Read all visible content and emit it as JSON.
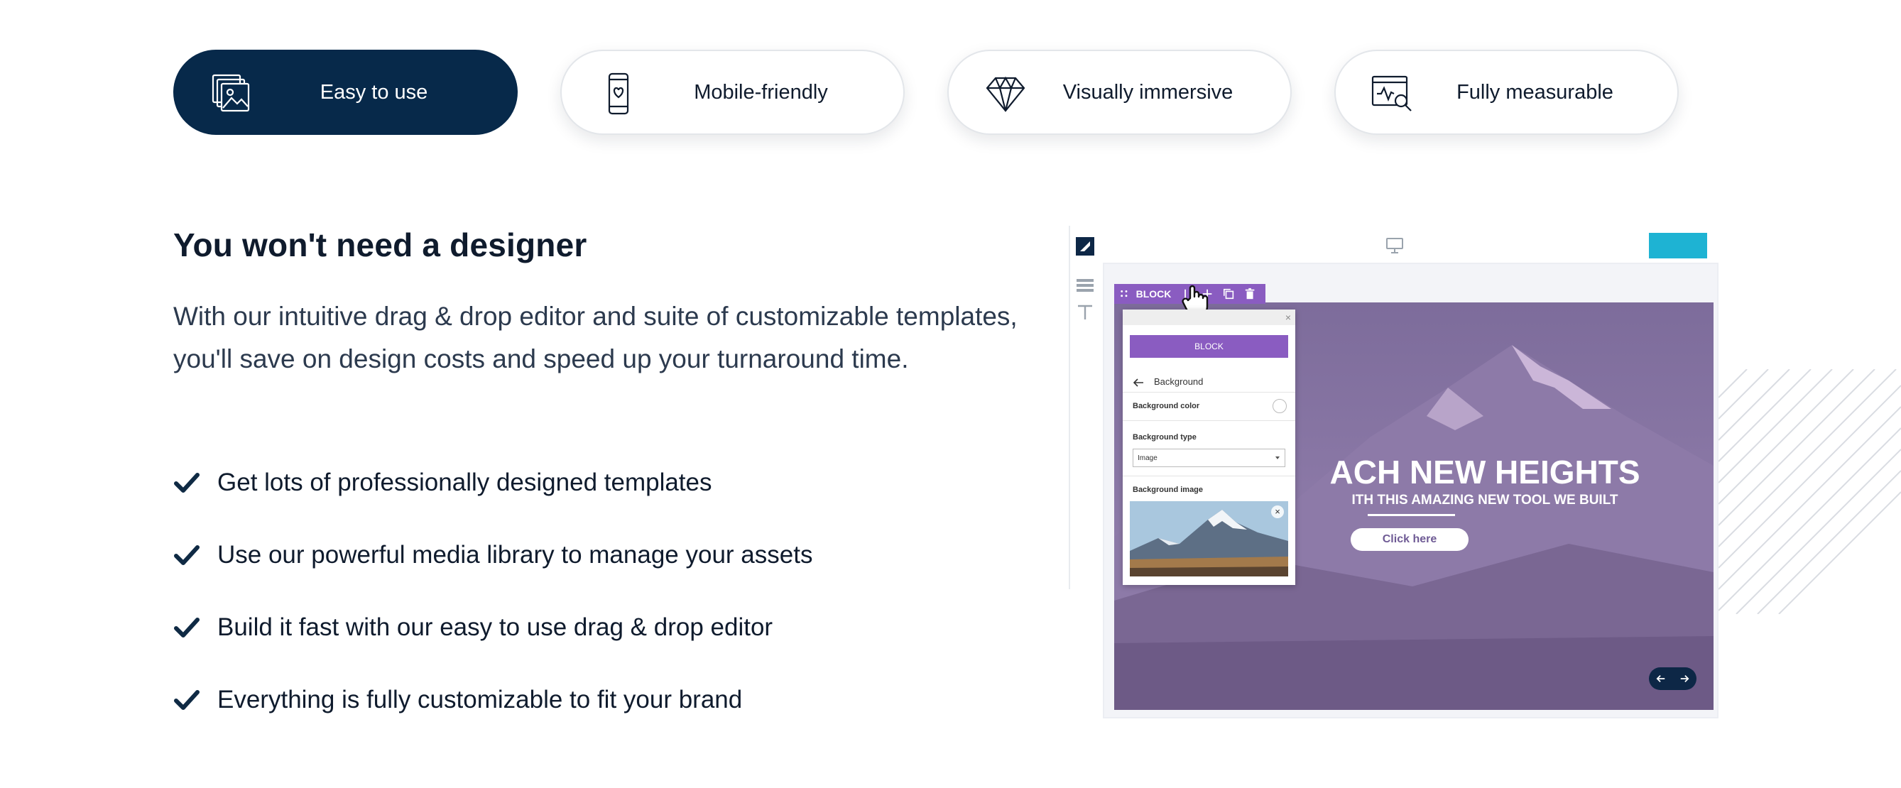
{
  "tabs": [
    {
      "label": "Easy to use",
      "icon": "images-icon",
      "active": true
    },
    {
      "label": "Mobile-friendly",
      "icon": "mobile-heart-icon",
      "active": false
    },
    {
      "label": "Visually immersive",
      "icon": "diamond-icon",
      "active": false
    },
    {
      "label": "Fully measurable",
      "icon": "analytics-icon",
      "active": false
    }
  ],
  "content": {
    "heading": "You won't need a designer",
    "intro": "With our intuitive drag & drop editor and suite of customizable templates, you'll save on design costs and speed up your turnaround time.",
    "features": [
      "Get lots of professionally designed templates",
      "Use our powerful media library to manage your assets",
      "Build it fast with our easy to use drag & drop editor",
      "Everything is fully customizable to fit your brand"
    ]
  },
  "editor": {
    "toolbar_label": "BLOCK",
    "panel": {
      "block_button": "BLOCK",
      "title": "Background",
      "bg_color_label": "Background color",
      "bg_type_label": "Background type",
      "bg_type_value": "Image",
      "bg_image_label": "Background image"
    },
    "hero": {
      "title": "ACH NEW HEIGHTS",
      "subtitle": "ITH THIS AMAZING NEW TOOL WE BUILT",
      "button": "Click here"
    }
  },
  "colors": {
    "navy": "#07294a",
    "purple": "#8a5cc1",
    "cyan": "#1eb3d3"
  }
}
